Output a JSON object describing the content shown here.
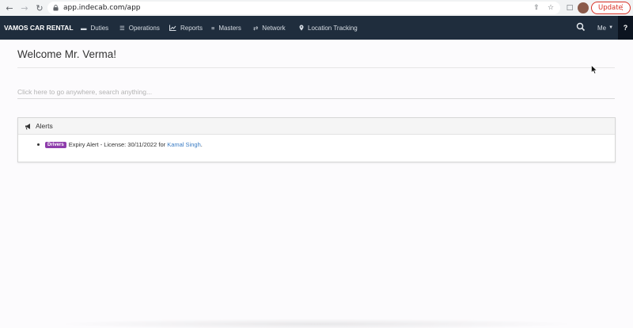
{
  "browser": {
    "url": "app.indecab.com/app",
    "update_label": "Update"
  },
  "navbar": {
    "brand": "VAMOS CAR RENTAL",
    "items": [
      {
        "label": "Duties",
        "icon": "minus-icon"
      },
      {
        "label": "Operations",
        "icon": "list-icon"
      },
      {
        "label": "Reports",
        "icon": "line-chart-icon"
      },
      {
        "label": "Masters",
        "icon": "stack-icon"
      },
      {
        "label": "Network",
        "icon": "shuffle-icon"
      },
      {
        "label": "Location Tracking",
        "icon": "map-pin-icon"
      }
    ],
    "me_label": "Me",
    "help_label": "?"
  },
  "main": {
    "welcome": "Welcome Mr. Verma!",
    "search_placeholder": "Click here to go anywhere, search anything..."
  },
  "alerts": {
    "title": "Alerts",
    "items": [
      {
        "badge": "Drivers",
        "text": "Expiry Alert - License: 30/11/2022 for",
        "link": "Kamal Singh",
        "suffix": "."
      }
    ]
  },
  "colors": {
    "navbar_bg": "#1f2d3d",
    "badge": "#8e3dab",
    "link": "#3a7cc4",
    "update": "#d93025"
  }
}
